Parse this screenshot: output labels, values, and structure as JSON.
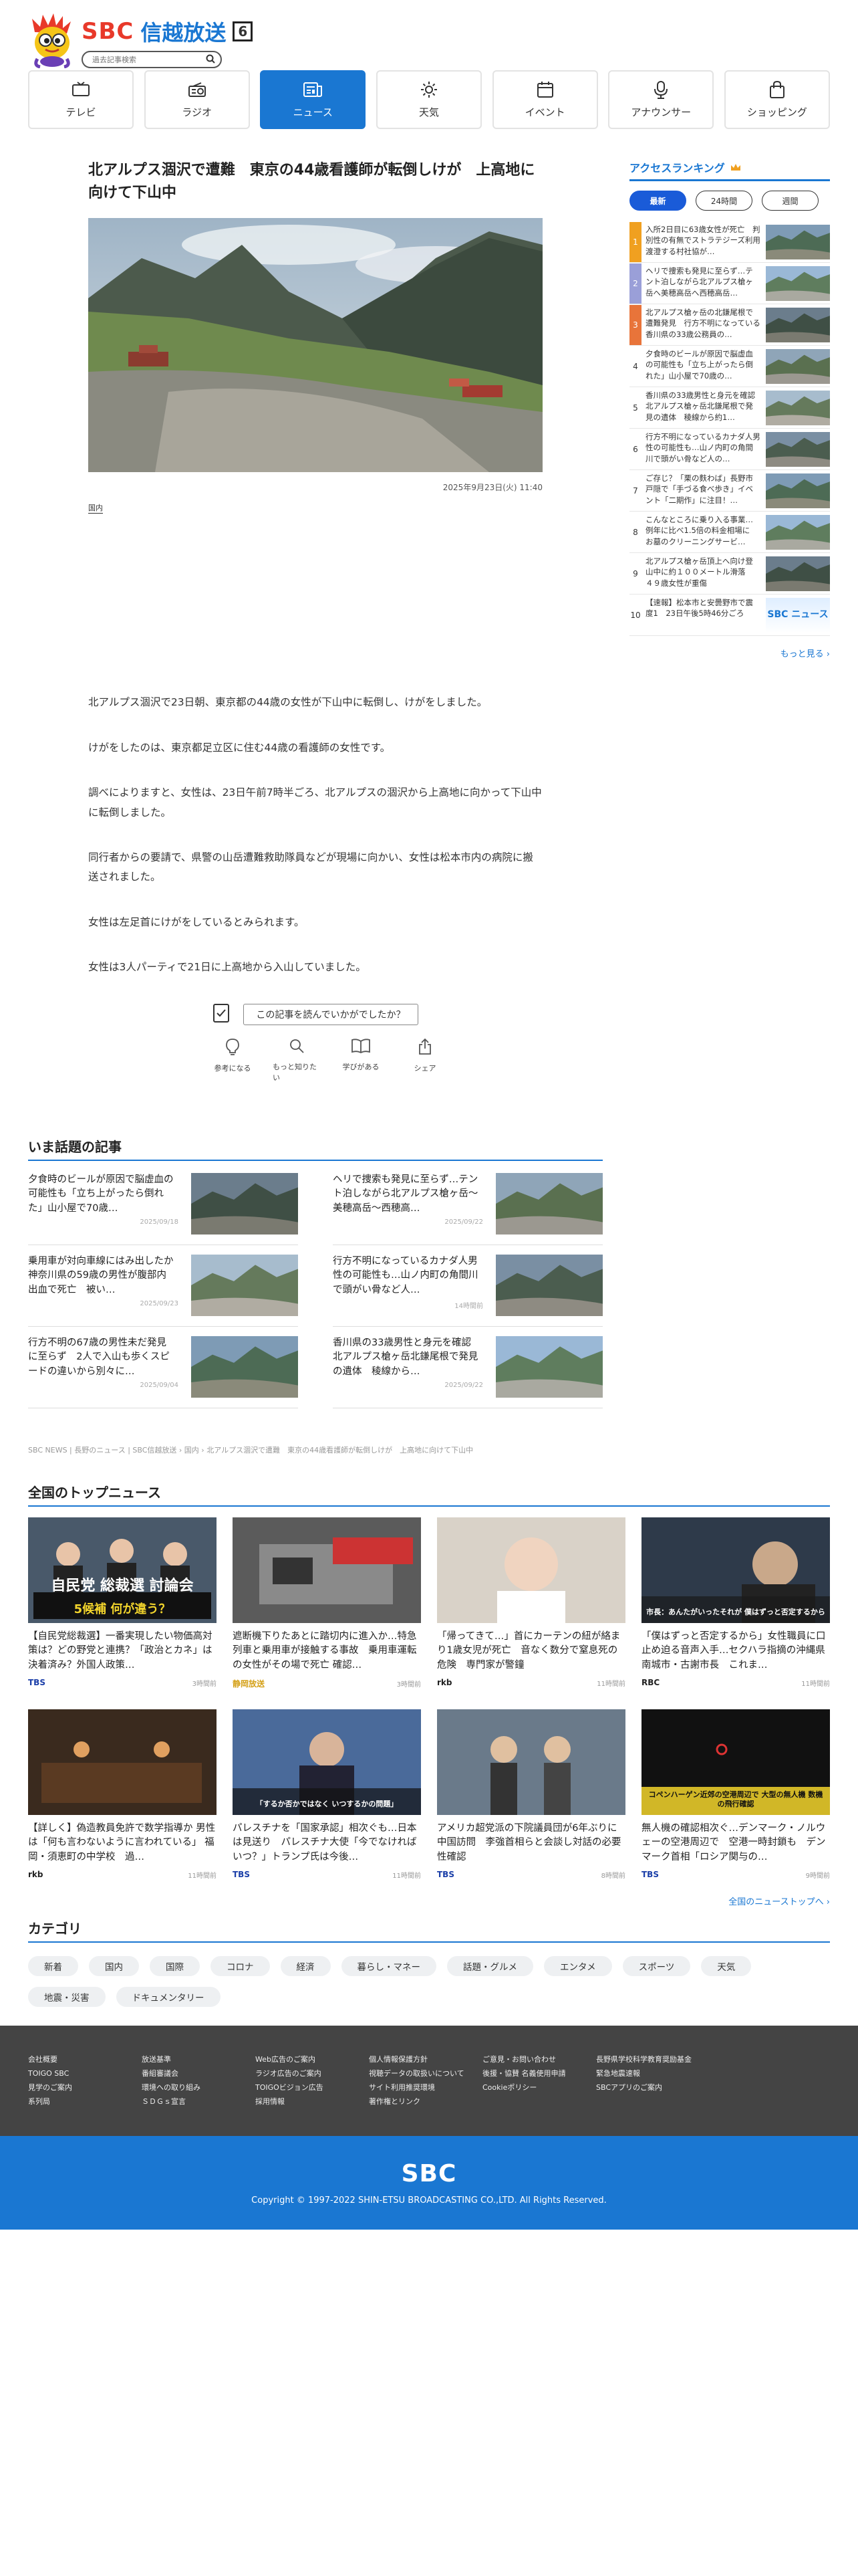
{
  "site": {
    "brand": "SBC",
    "name": "信越放送",
    "channel": "6",
    "search_placeholder": "過去記事検索"
  },
  "nav": [
    {
      "label": "テレビ",
      "icon": "tv-icon"
    },
    {
      "label": "ラジオ",
      "icon": "radio-icon"
    },
    {
      "label": "ニュース",
      "icon": "news-icon",
      "active": true
    },
    {
      "label": "天気",
      "icon": "sun-icon"
    },
    {
      "label": "イベント",
      "icon": "calendar-icon"
    },
    {
      "label": "アナウンサー",
      "icon": "microphone-icon"
    },
    {
      "label": "ショッピング",
      "icon": "shopping-bag-icon"
    }
  ],
  "article": {
    "title": "北アルプス涸沢で遭難　東京の44歳看護師が転倒しけが　上高地に向けて下山中",
    "date": "2025年9月23日(火) 11:40",
    "category": "国内",
    "paragraphs": [
      "北アルプス涸沢で23日朝、東京都の44歳の女性が下山中に転倒し、けがをしました。",
      "けがをしたのは、東京都足立区に住む44歳の看護師の女性です。",
      "調べによりますと、女性は、23日午前7時半ごろ、北アルプスの涸沢から上高地に向かって下山中に転倒しました。",
      "同行者からの要請で、県警の山岳遭難救助隊員などが現場に向かい、女性は松本市内の病院に搬送されました。",
      "女性は左足首にけがをしているとみられます。",
      "女性は3人パーティで21日に上高地から入山していました。"
    ],
    "feedback_label": "この記事を読んでいかがでしたか？",
    "reactions": [
      "参考になる",
      "もっと知りたい",
      "学びがある",
      "シェア"
    ]
  },
  "ranking": {
    "title": "アクセスランキング",
    "tabs": [
      "最新",
      "24時間",
      "週間"
    ],
    "items": [
      {
        "rank": "1",
        "text": "入所2日目に63歳女性が死亡　判別性の有無でストラテジーズ利用　渡澄する村社協が…",
        "color": "#f0a020"
      },
      {
        "rank": "2",
        "text": "ヘリで捜索も発見に至らず…テント泊しながら北アルプス槍ヶ岳へ美穂高岳へ西穂高岳…",
        "color": "#9a9fd8"
      },
      {
        "rank": "3",
        "text": "北アルプス槍ヶ岳の北鎌尾根で遭難発見　行方不明になっている香川県の33歳公務員の…",
        "color": "#e8743a"
      },
      {
        "rank": "4",
        "text": "夕食時のビールが原因で脳虚血の可能性も「立ち上がったら倒れた」山小屋で70歳の…",
        "color": ""
      },
      {
        "rank": "5",
        "text": "香川県の33歳男性と身元を確認　北アルプス槍ヶ岳北鎌尾根で発見の遺体　稜線から約1…",
        "color": ""
      },
      {
        "rank": "6",
        "text": "行方不明になっているカナダ人男性の可能性も…山ノ内町の角間川で頭がい骨など人の…",
        "color": ""
      },
      {
        "rank": "7",
        "text": "ご存じ？「栗の麩わば」長野市戸隠で「手づる食べ歩き」イベント「二期作」に注目！…",
        "color": ""
      },
      {
        "rank": "8",
        "text": "こんなところに乗り入る事業…例年に比べ1.5倍の料金相場に　お墓のクリーニングサービ…",
        "color": ""
      },
      {
        "rank": "9",
        "text": "北アルプス槍ヶ岳頂上へ向け登山中に約１００メートル滑落　４９歳女性が重傷",
        "color": ""
      },
      {
        "rank": "10",
        "text": "【速報】松本市と安曇野市で震度1　23日午後5時46分ごろ",
        "color": ""
      }
    ],
    "more": "もっと見る"
  },
  "trending": {
    "title": "いま話題の記事",
    "items": [
      {
        "title": "夕食時のビールが原因で脳虚血の可能性も「立ち上がったら倒れた」山小屋で70歳…",
        "date": "2025/09/18"
      },
      {
        "title": "ヘリで捜索も発見に至らず…テント泊しながら北アルプス槍ヶ岳〜美穂高岳〜西穂高…",
        "date": "2025/09/22"
      },
      {
        "title": "乗用車が対向車線にはみ出したか　神奈川県の59歳の男性が腹部内出血で死亡　被い…",
        "date": "2025/09/23"
      },
      {
        "title": "行方不明になっているカナダ人男性の可能性も…山ノ内町の角間川で頭がい骨など人…",
        "date": "14時間前"
      },
      {
        "title": "行方不明の67歳の男性未だ発見に至らず　2人で入山も歩くスピードの違いから別々に…",
        "date": "2025/09/04"
      },
      {
        "title": "香川県の33歳男性と身元を確認　北アルプス槍ヶ岳北鎌尾根で発見の遺体　稜線から…",
        "date": "2025/09/22"
      }
    ]
  },
  "breadcrumb": "SBC NEWS | 長野のニュース | SBC信越放送 › 国内 › 北アルプス涸沢で遭難　東京の44歳看護師が転倒しけが　上高地に向けて下山中",
  "national": {
    "title": "全国のトップニュース",
    "items": [
      {
        "title": "【自民党総裁選】一番実現したい物価高対策は？どの野党と連携？「政治とカネ」は決着済み？外国人政策…",
        "source": "TBS",
        "time": "3時間前",
        "src_color": "#1a3ea8"
      },
      {
        "title": "遮断機下りたあとに踏切内に進入か…特急列車と乗用車が接触する事故　乗用車運転の女性がその場で死亡 確認…",
        "source": "静岡放送",
        "time": "3時間前",
        "src_color": "#d4a017"
      },
      {
        "title": "「帰ってきて…」首にカーテンの紐が絡まり1歳女児が死亡　音なく数分で窒息死の危険　専門家が警鐘",
        "source": "rkb",
        "time": "11時間前",
        "src_color": "#222"
      },
      {
        "title": "「僕はずっと否定するから」女性職員に口止め迫る音声入手…セクハラ指摘の沖縄県南城市・古謝市長　これま…",
        "source": "RBC",
        "time": "11時間前",
        "src_color": "#222"
      },
      {
        "title": "【詳しく】偽造教員免許で数学指導か 男性は「何も言わないように言われている」 福岡・須恵町の中学校　過…",
        "source": "rkb",
        "time": "11時間前",
        "src_color": "#222"
      },
      {
        "title": "パレスチナを「国家承認」相次ぐも…日本は見送り　パレスチナ大使「今でなければいつ？」トランプ氏は今後…",
        "source": "TBS",
        "time": "11時間前",
        "src_color": "#1a3ea8"
      },
      {
        "title": "アメリカ超党派の下院議員団が6年ぶりに中国訪問　李強首相らと会談し対話の必要性確認",
        "source": "TBS",
        "time": "8時間前",
        "src_color": "#1a3ea8"
      },
      {
        "title": "無人機の確認相次ぐ…デンマーク・ノルウェーの空港周辺で　空港一時封鎖も　デンマーク首相「ロシア関与の…",
        "source": "TBS",
        "time": "9時間前",
        "src_color": "#1a3ea8"
      }
    ],
    "more": "全国のニューストップへ"
  },
  "thumb_text": {
    "sbc_news": "SBC ニュース",
    "n1_caption": "5候補 何が違う？",
    "n1_title": "自民党 総裁選 討論会",
    "n4_caption": "市長：あんたがいったそれが 僕はずっと否定するから",
    "n6_caption": "「するか否かではなく いつするかの問題」",
    "n8_caption": "コペンハーゲン近郊の空港周辺で 大型の無人機 数機の飛行確認"
  },
  "categories": {
    "title": "カテゴリ",
    "items": [
      "新着",
      "国内",
      "国際",
      "コロナ",
      "経済",
      "暮らし・マネー",
      "話題・グルメ",
      "エンタメ",
      "スポーツ",
      "天気",
      "地震・災害",
      "ドキュメンタリー"
    ]
  },
  "footer": {
    "columns": [
      [
        "会社概要",
        "TOIGO SBC",
        "見学のご案内",
        "系列局"
      ],
      [
        "放送基準",
        "番組審議会",
        "環境への取り組み",
        "ＳＤＧｓ宣言"
      ],
      [
        "Web広告のご案内",
        "ラジオ広告のご案内",
        "TOIGOビジョン広告",
        "採用情報"
      ],
      [
        "個人情報保護方針",
        "視聴データの取扱いについて",
        "サイト利用推奨環境",
        "著作権とリンク"
      ],
      [
        "ご意見・お問い合わせ",
        "後援・協賛 名義使用申請",
        "Cookieポリシー"
      ],
      [
        "長野県学校科学教育奨励基金",
        "緊急地震速報",
        "SBCアプリのご案内"
      ]
    ],
    "logo": "SBC",
    "copyright": "Copyright © 1997-2022 SHIN-ETSU BROADCASTING CO.,LTD. All Rights Reserved."
  }
}
